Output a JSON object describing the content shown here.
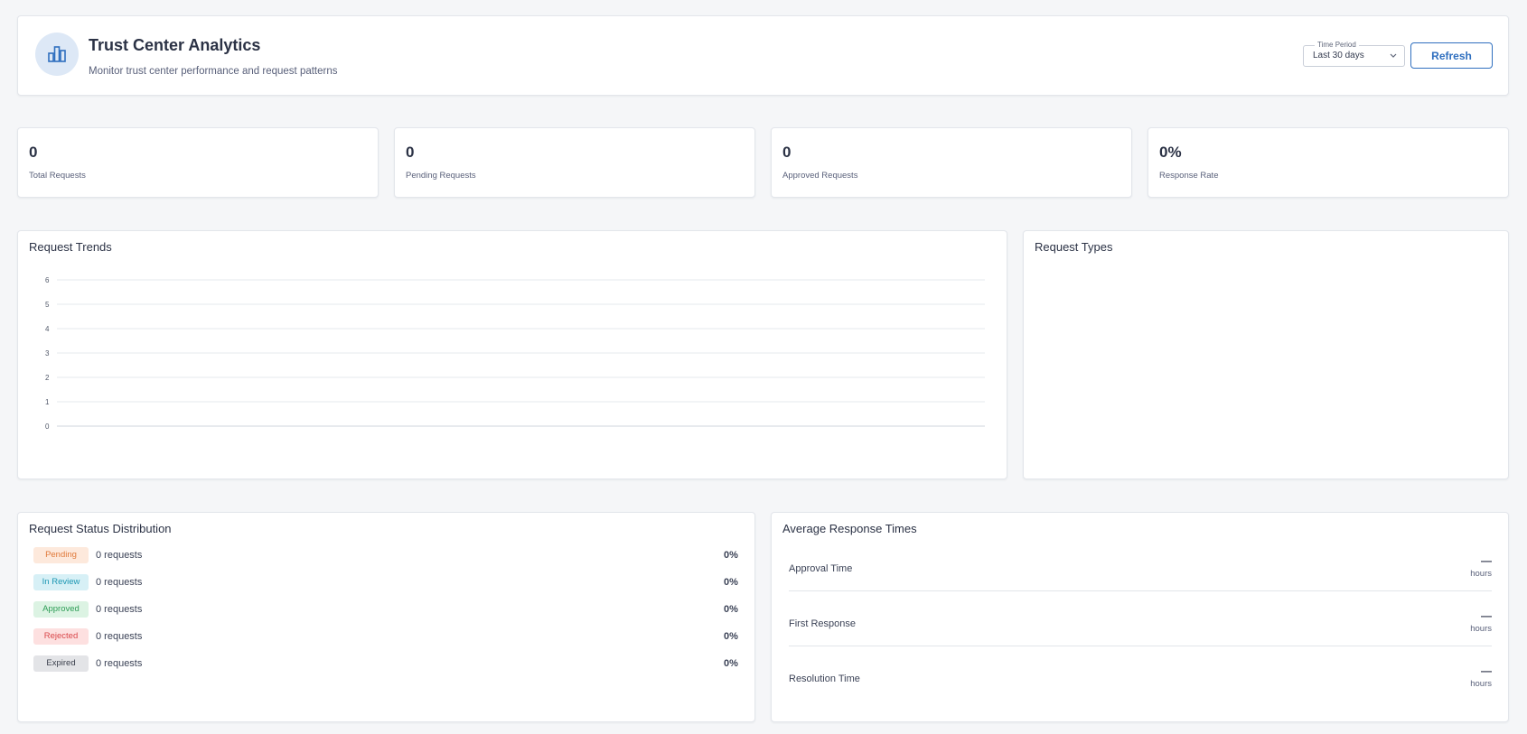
{
  "header": {
    "title": "Trust Center Analytics",
    "subtitle": "Monitor trust center performance and request patterns",
    "icon": "bar-chart-icon",
    "time_period": {
      "label": "Time Period",
      "value": "Last 30 days"
    },
    "refresh_label": "Refresh"
  },
  "stats": [
    {
      "value": "0",
      "label": "Total Requests"
    },
    {
      "value": "0",
      "label": "Pending Requests"
    },
    {
      "value": "0",
      "label": "Approved Requests"
    },
    {
      "value": "0%",
      "label": "Response Rate"
    }
  ],
  "trends": {
    "title": "Request Trends",
    "chart_data": {
      "type": "line",
      "title": "Request Trends",
      "y_ticks": [
        "0",
        "1",
        "2",
        "3",
        "4",
        "5",
        "6"
      ],
      "ylim": [
        0,
        6
      ],
      "grid": true,
      "series": []
    }
  },
  "types": {
    "title": "Request Types"
  },
  "status": {
    "title": "Request Status Distribution",
    "rows": [
      {
        "badge": "Pending",
        "count": "0 requests",
        "percent": "0%",
        "badge_bg": "#fde9dc",
        "badge_fg": "#e0793a"
      },
      {
        "badge": "In Review",
        "count": "0 requests",
        "percent": "0%",
        "badge_bg": "#d7f0f6",
        "badge_fg": "#1d97b3"
      },
      {
        "badge": "Approved",
        "count": "0 requests",
        "percent": "0%",
        "badge_bg": "#dcf3e3",
        "badge_fg": "#2e9d56"
      },
      {
        "badge": "Rejected",
        "count": "0 requests",
        "percent": "0%",
        "badge_bg": "#fde0e0",
        "badge_fg": "#d9474a"
      },
      {
        "badge": "Expired",
        "count": "0 requests",
        "percent": "0%",
        "badge_bg": "#e3e4e7",
        "badge_fg": "#3a3f4c"
      }
    ]
  },
  "response": {
    "title": "Average Response Times",
    "rows": [
      {
        "label": "Approval Time",
        "value": "—",
        "unit": "hours"
      },
      {
        "label": "First Response",
        "value": "—",
        "unit": "hours"
      },
      {
        "label": "Resolution Time",
        "value": "—",
        "unit": "hours"
      }
    ]
  },
  "colors": {
    "accent": "#2f6fbf",
    "icon_bg": "#dde8f6",
    "page_bg": "#f5f6f8"
  }
}
